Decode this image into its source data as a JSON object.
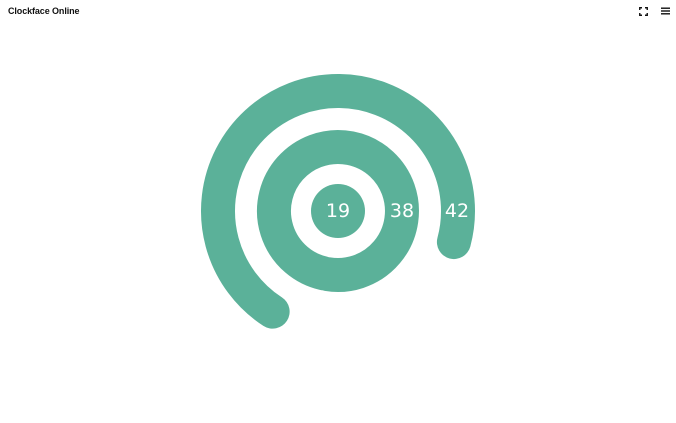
{
  "app": {
    "title": "Clockface Online"
  },
  "toolbar": {
    "fullscreen_icon": "fullscreen-icon",
    "menu_icon": "hamburger-menu-icon"
  },
  "clock": {
    "accent_color": "#5bb199",
    "hours": "19",
    "minutes": "38",
    "seconds": "42",
    "progress": {
      "hours_fraction": 0.79,
      "minutes_fraction": 0.64,
      "seconds_fraction": 0.7
    }
  }
}
